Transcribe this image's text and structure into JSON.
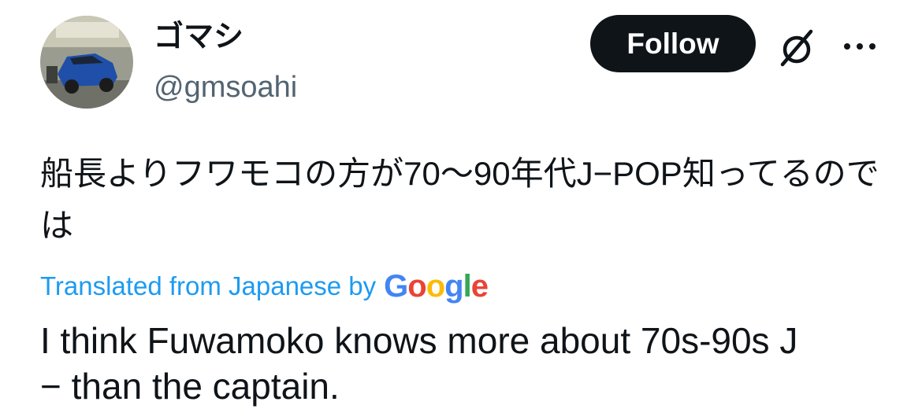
{
  "author": {
    "display_name": "ゴマシ",
    "handle": "@gmsoahi",
    "avatar_icon": "car-photo-avatar"
  },
  "header": {
    "follow_label": "Follow",
    "grok_icon": "slashed-circle-icon",
    "more_icon": "more-horizontal-icon"
  },
  "tweet": {
    "text": "船長よりフワモコの方が70〜90年代J−POP知ってるのでは"
  },
  "translation": {
    "label": "Translated from Japanese by",
    "provider_logo": "Google",
    "text": "I think Fuwamoko knows more about 70s-90s J − than the captain."
  },
  "colors": {
    "text_primary": "#0f1419",
    "text_secondary": "#536471",
    "link_blue": "#1d9bf0",
    "follow_bg": "#0f1419",
    "follow_text": "#ffffff"
  }
}
